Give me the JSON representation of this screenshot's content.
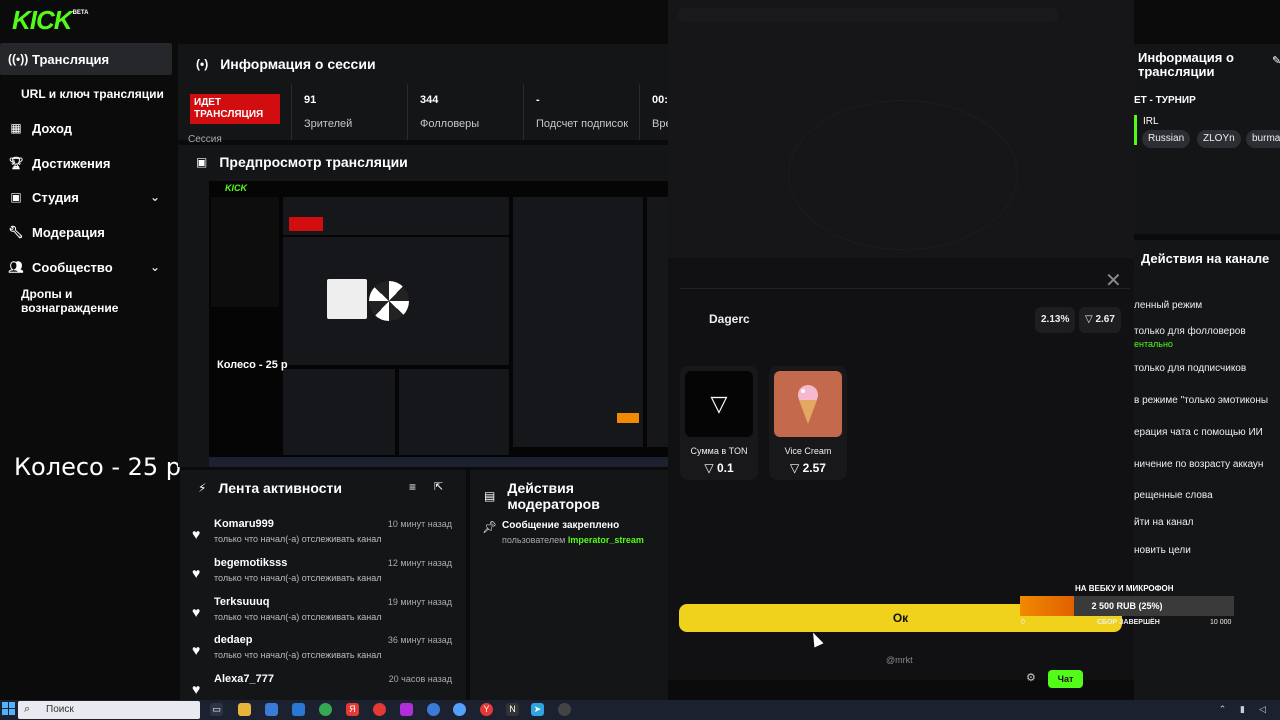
{
  "logo": {
    "text": "KICK",
    "badge": "BETA"
  },
  "sidebar": {
    "items": [
      {
        "label": "Трансляция",
        "icon": "broadcast-icon"
      },
      {
        "label": "URL и ключ трансляции",
        "icon": ""
      },
      {
        "label": "Доход",
        "icon": "chart-icon"
      },
      {
        "label": "Достижения",
        "icon": "trophy-icon"
      },
      {
        "label": "Студия",
        "icon": "studio-icon"
      },
      {
        "label": "Модерация",
        "icon": "wrench-icon"
      },
      {
        "label": "Сообщество",
        "icon": "people-icon"
      },
      {
        "label": "Дропы и вознаграждение",
        "icon": ""
      }
    ]
  },
  "overlay_text": "Колесо - 25 р",
  "session": {
    "title": "Информация о сессии",
    "live_label": "ИДЕТ ТРАНСЛЯЦИЯ",
    "sub_label": "Сессия",
    "stats": [
      {
        "value": "91",
        "label": "Зрителей"
      },
      {
        "value": "344",
        "label": "Фолловеры"
      },
      {
        "value": "-",
        "label": "Подсчет подписок"
      },
      {
        "value": "00:",
        "label": "Вре"
      }
    ]
  },
  "preview": {
    "title": "Предпросмотр трансляции",
    "wheel_label": "Колесо - 25 р"
  },
  "activity": {
    "title": "Лента активности",
    "rows": [
      {
        "name": "Komaru999",
        "time": "10 минут назад",
        "desc": "только что начал(-а) отслеживать канал"
      },
      {
        "name": "begemotiksss",
        "time": "12 минут назад",
        "desc": "только что начал(-а) отслеживать канал"
      },
      {
        "name": "Terksuuuq",
        "time": "19 минут назад",
        "desc": "только что начал(-а) отслеживать канал"
      },
      {
        "name": "dedaep",
        "time": "36 минут назад",
        "desc": "только что начал(-а) отслеживать канал"
      },
      {
        "name": "Alexa7_777",
        "time": "20 часов назад",
        "desc": ""
      }
    ]
  },
  "mod_actions": {
    "title": "Действия модераторов",
    "event": "Сообщение закреплено",
    "by_prefix": "пользователем",
    "by_user": "Imperator_stream"
  },
  "stream_info": {
    "title": "Информация о трансляции",
    "stream_title": "ЕТ - ТУРНИР",
    "category": "IRL",
    "tags": [
      "Russian",
      "ZLOYn",
      "burma"
    ]
  },
  "channel_actions": {
    "title": "Действия на канале",
    "items": [
      "ленный режим",
      "только для фолловеров",
      "ентально",
      "только для подписчиков",
      "в режиме \"только эмотиконы",
      "ерация чата с помощью ИИ",
      "ничение по возрасту аккаун",
      "рещенные слова",
      "йти на канал",
      "новить цели"
    ]
  },
  "modal": {
    "name": "Dagerc",
    "percent": "2.13%",
    "price": "2.67",
    "cards": [
      {
        "title": "Сумма в TON",
        "price": "0.1"
      },
      {
        "title": "Vice Cream",
        "price": "2.57"
      }
    ],
    "ok_label": "Ок",
    "footer": "@mrkt"
  },
  "goal": {
    "title": "НА ВЕБКУ И МИКРОФОН",
    "amount": "2 500 RUB (25%)",
    "progress": 0.25,
    "min": "0",
    "status": "СБОР ЗАВЕРШЁН",
    "max": "10 000"
  },
  "chat_button": "Чат",
  "taskbar": {
    "search_placeholder": "Поиск"
  },
  "colors": {
    "kick_green": "#53fc18",
    "live_red": "#d10d10",
    "ok_yellow": "#f0d11c",
    "goal_orange": "#f08a00"
  }
}
